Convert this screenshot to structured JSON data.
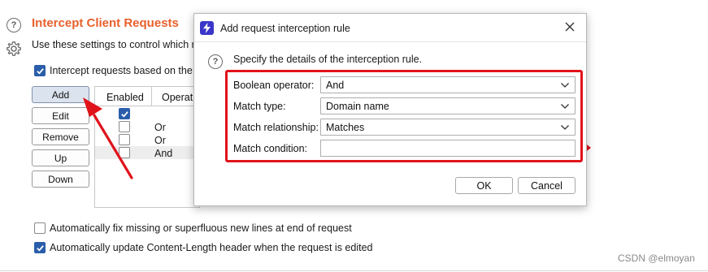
{
  "section": {
    "title": "Intercept Client Requests",
    "description": "Use these settings to control which re",
    "intercept_label": "Intercept requests based on the fo"
  },
  "buttons": {
    "add": "Add",
    "edit": "Edit",
    "remove": "Remove",
    "up": "Up",
    "down": "Down"
  },
  "table": {
    "columns": [
      "Enabled",
      "Operat"
    ],
    "rows": [
      {
        "enabled": true,
        "operator": ""
      },
      {
        "enabled": false,
        "operator": "Or"
      },
      {
        "enabled": false,
        "operator": "Or"
      },
      {
        "enabled": false,
        "operator": "And"
      }
    ]
  },
  "options": {
    "fix_newlines": "Automatically fix missing or superfluous new lines at end of request",
    "update_content_length": "Automatically update Content-Length header when the request is edited",
    "fix_newlines_checked": false,
    "update_content_length_checked": true
  },
  "dialog": {
    "title": "Add request interception rule",
    "instruction": "Specify the details of the interception rule.",
    "fields": {
      "boolean_operator_label": "Boolean operator:",
      "boolean_operator_value": "And",
      "match_type_label": "Match type:",
      "match_type_value": "Domain name",
      "match_relationship_label": "Match relationship:",
      "match_relationship_value": "Matches",
      "match_condition_label": "Match condition:",
      "match_condition_value": ""
    },
    "ok_label": "OK",
    "cancel_label": "Cancel"
  },
  "watermark": "CSDN @elmoyan",
  "colors": {
    "accent_orange": "#e8602c",
    "highlight_red": "#e0131b",
    "check_blue": "#2b5eaa"
  }
}
